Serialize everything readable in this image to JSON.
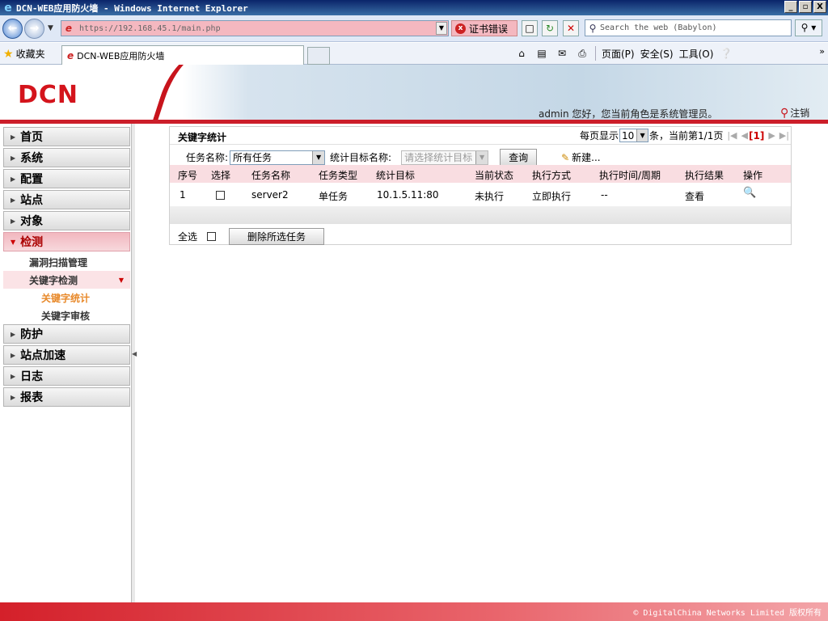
{
  "window": {
    "title": "DCN-WEB应用防火墙 - Windows Internet Explorer",
    "buttons": [
      "_",
      "▫",
      "X"
    ]
  },
  "address": {
    "url": "https://192.168.45.1/main.php",
    "cert_error": "证书错误"
  },
  "search": {
    "placeholder": "Search the web (Babylon)"
  },
  "favorites": {
    "label": "收藏夹",
    "tab_title": "DCN-WEB应用防火墙"
  },
  "command_bar": {
    "page": "页面(P)",
    "safety": "安全(S)",
    "tools": "工具(O)"
  },
  "header": {
    "logo": "DCN",
    "welcome": "admin 您好，您当前角色是系统管理员。",
    "logout": "注销"
  },
  "sidebar": {
    "items": [
      {
        "label": "首页"
      },
      {
        "label": "系统"
      },
      {
        "label": "配置"
      },
      {
        "label": "站点"
      },
      {
        "label": "对象"
      },
      {
        "label": "检测"
      },
      {
        "label": "防护"
      },
      {
        "label": "站点加速"
      },
      {
        "label": "日志"
      },
      {
        "label": "报表"
      }
    ],
    "submenu": {
      "vuln_scan": "漏洞扫描管理",
      "keyword_detect": "关键字检测",
      "keyword_stats": "关键字统计",
      "keyword_audit": "关键字审核"
    }
  },
  "panel": {
    "title": "关键字统计",
    "per_page_label": "每页显示",
    "per_page_value": "10",
    "page_info": "条，当前第1/1页",
    "current_page": "[1]",
    "filter": {
      "task_name_label": "任务名称:",
      "task_name_value": "所有任务",
      "target_label": "统计目标名称:",
      "target_placeholder": "请选择统计目标",
      "query_button": "查询",
      "new_button": "新建..."
    },
    "columns": [
      "序号",
      "选择",
      "任务名称",
      "任务类型",
      "统计目标",
      "当前状态",
      "执行方式",
      "执行时间/周期",
      "执行结果",
      "操作"
    ],
    "rows": [
      {
        "index": "1",
        "task_name": "server2",
        "task_type": "单任务",
        "target": "10.1.5.11:80",
        "status": "未执行",
        "mode": "立即执行",
        "time": "--",
        "result": "查看"
      }
    ],
    "select_all": "全选",
    "delete_button": "删除所选任务"
  },
  "footer": {
    "copyright": "© DigitalChina Networks Limited 版权所有"
  }
}
